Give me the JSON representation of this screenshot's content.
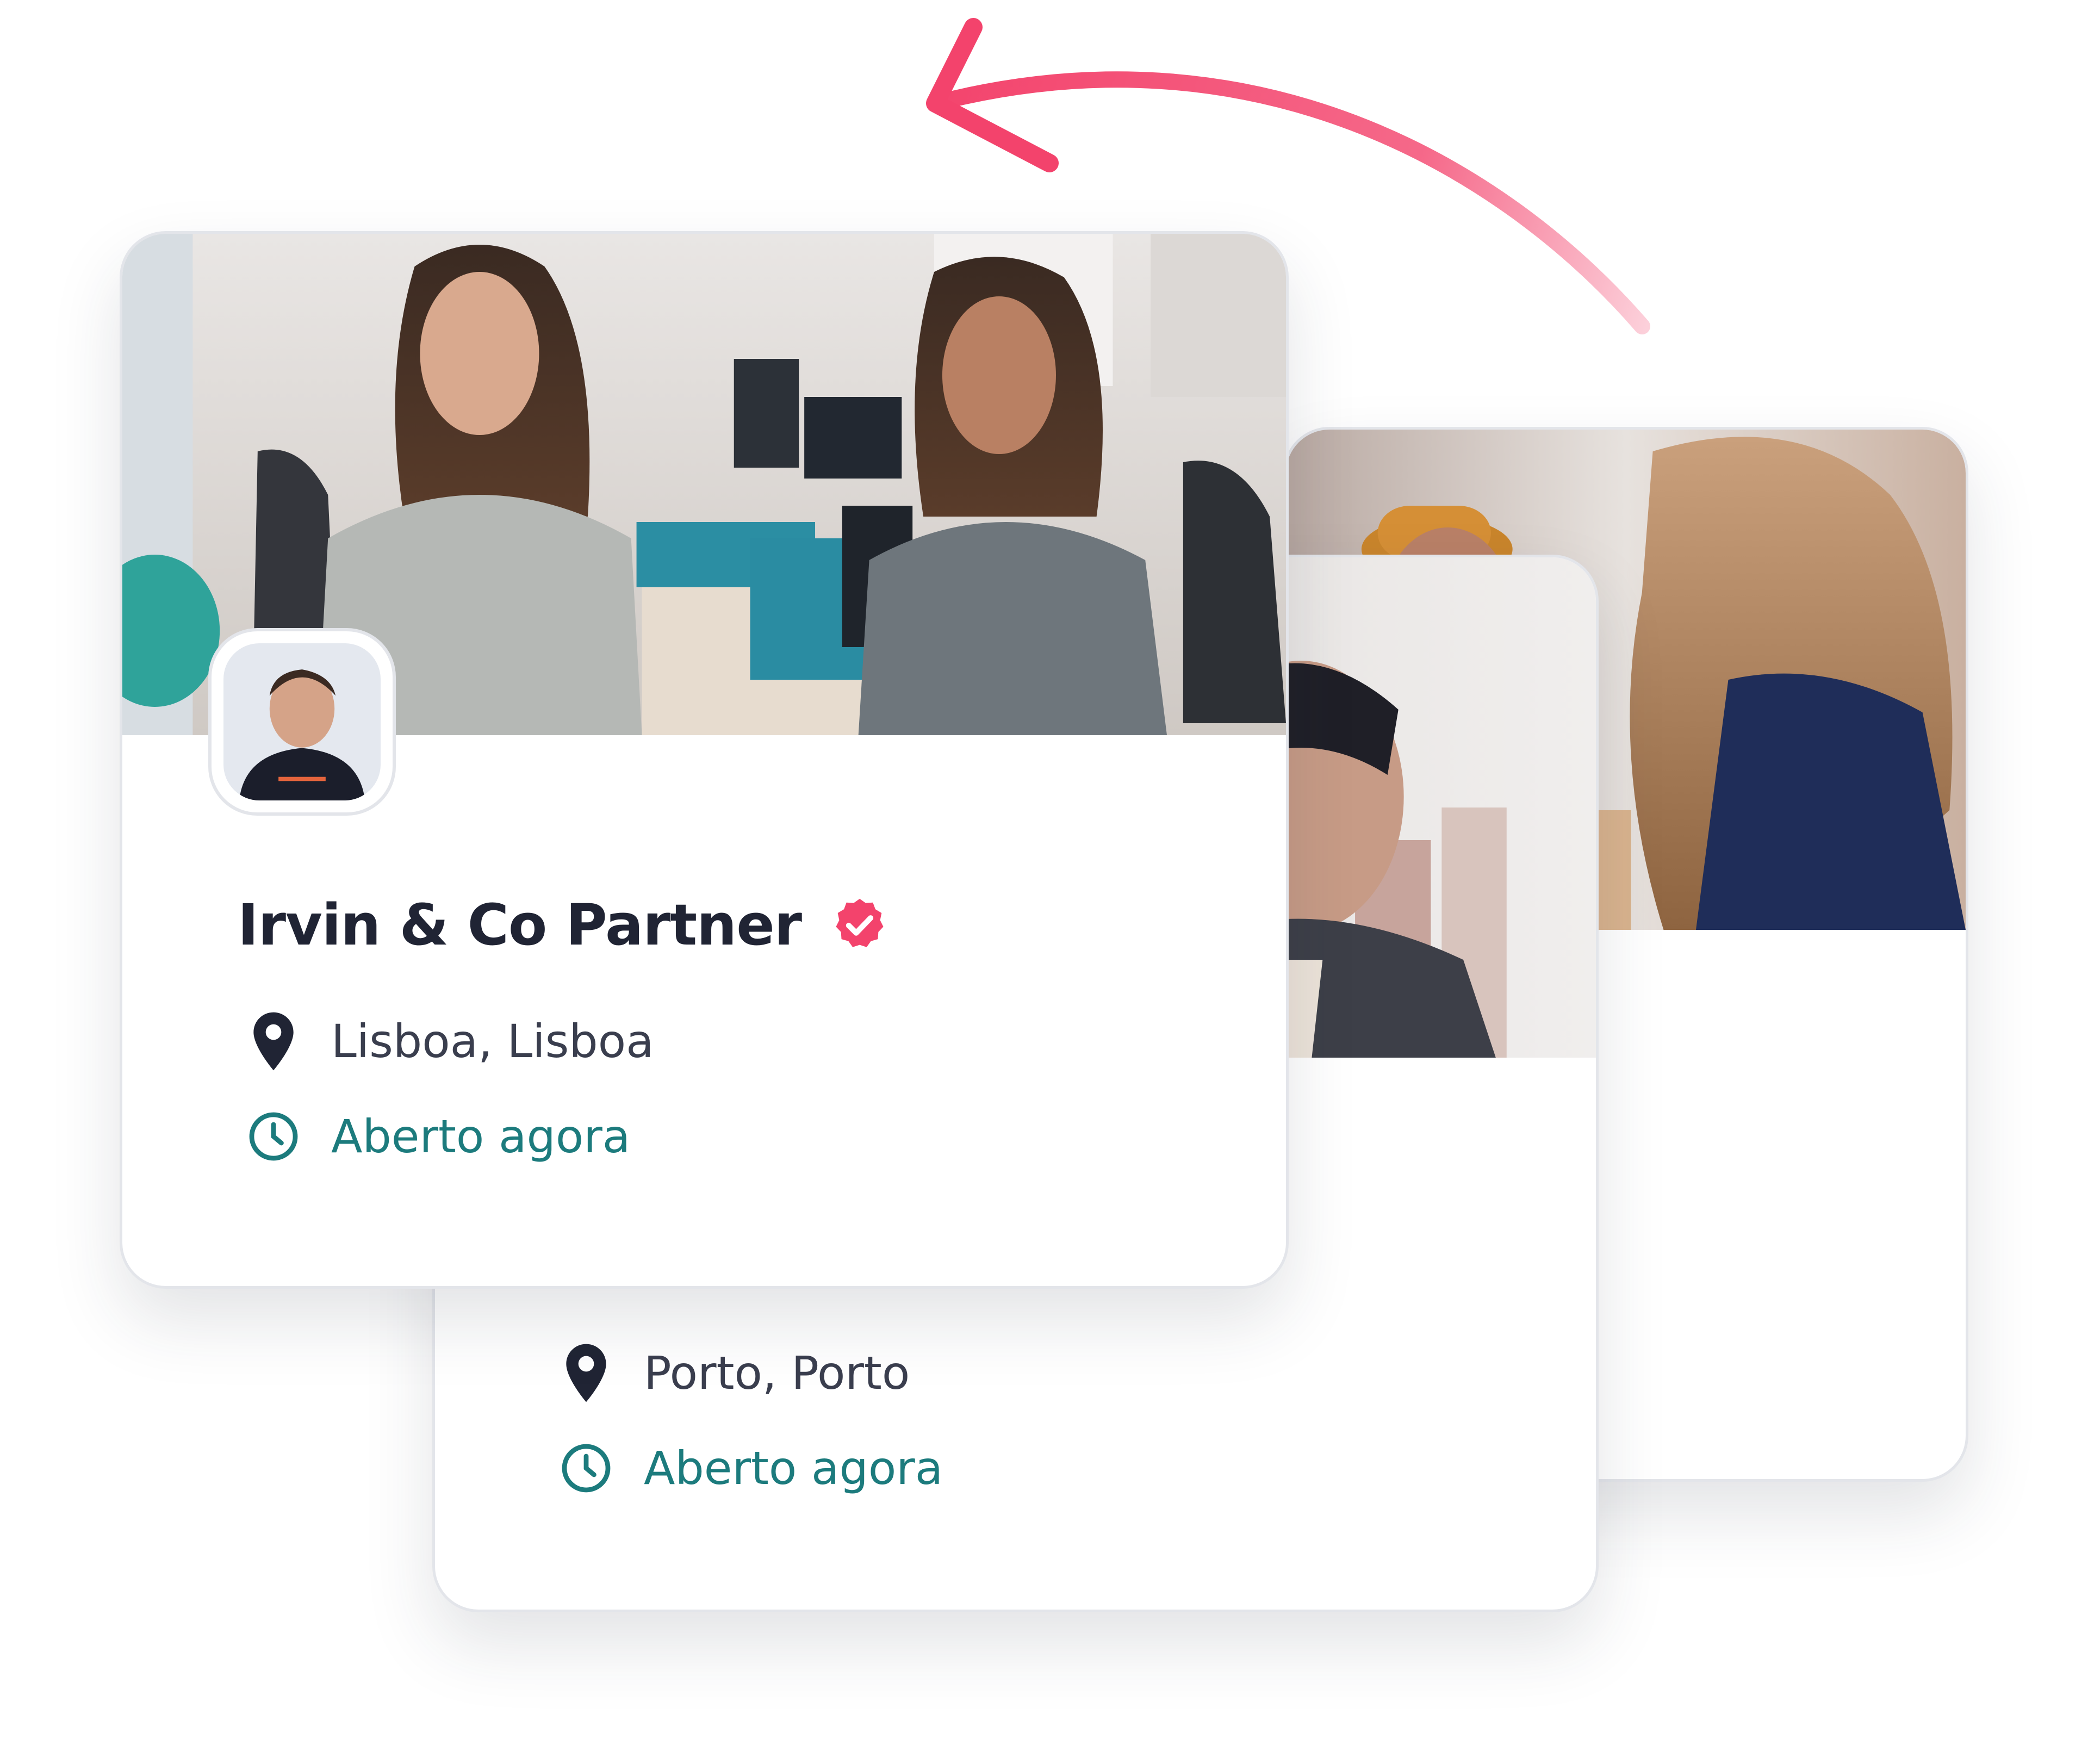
{
  "colors": {
    "accent_pink": "#f3436c",
    "teal_status": "#1c7b7d",
    "title_text": "#202434",
    "body_text": "#3a3e4e",
    "card_border": "#e3e5ea"
  },
  "cards": {
    "front": {
      "name": "Irvin & Co Partner",
      "verified_icon": "verified-badge-icon",
      "location_icon": "map-pin-icon",
      "location": "Lisboa, Lisboa",
      "status_icon": "clock-icon",
      "status": "Aberto agora"
    },
    "middle": {
      "location_icon": "map-pin-icon",
      "location": "Porto, Porto",
      "status_icon": "clock-icon",
      "status": "Aberto agora"
    },
    "back": {}
  },
  "decoration": {
    "arrow_icon": "curved-arrow-icon"
  }
}
